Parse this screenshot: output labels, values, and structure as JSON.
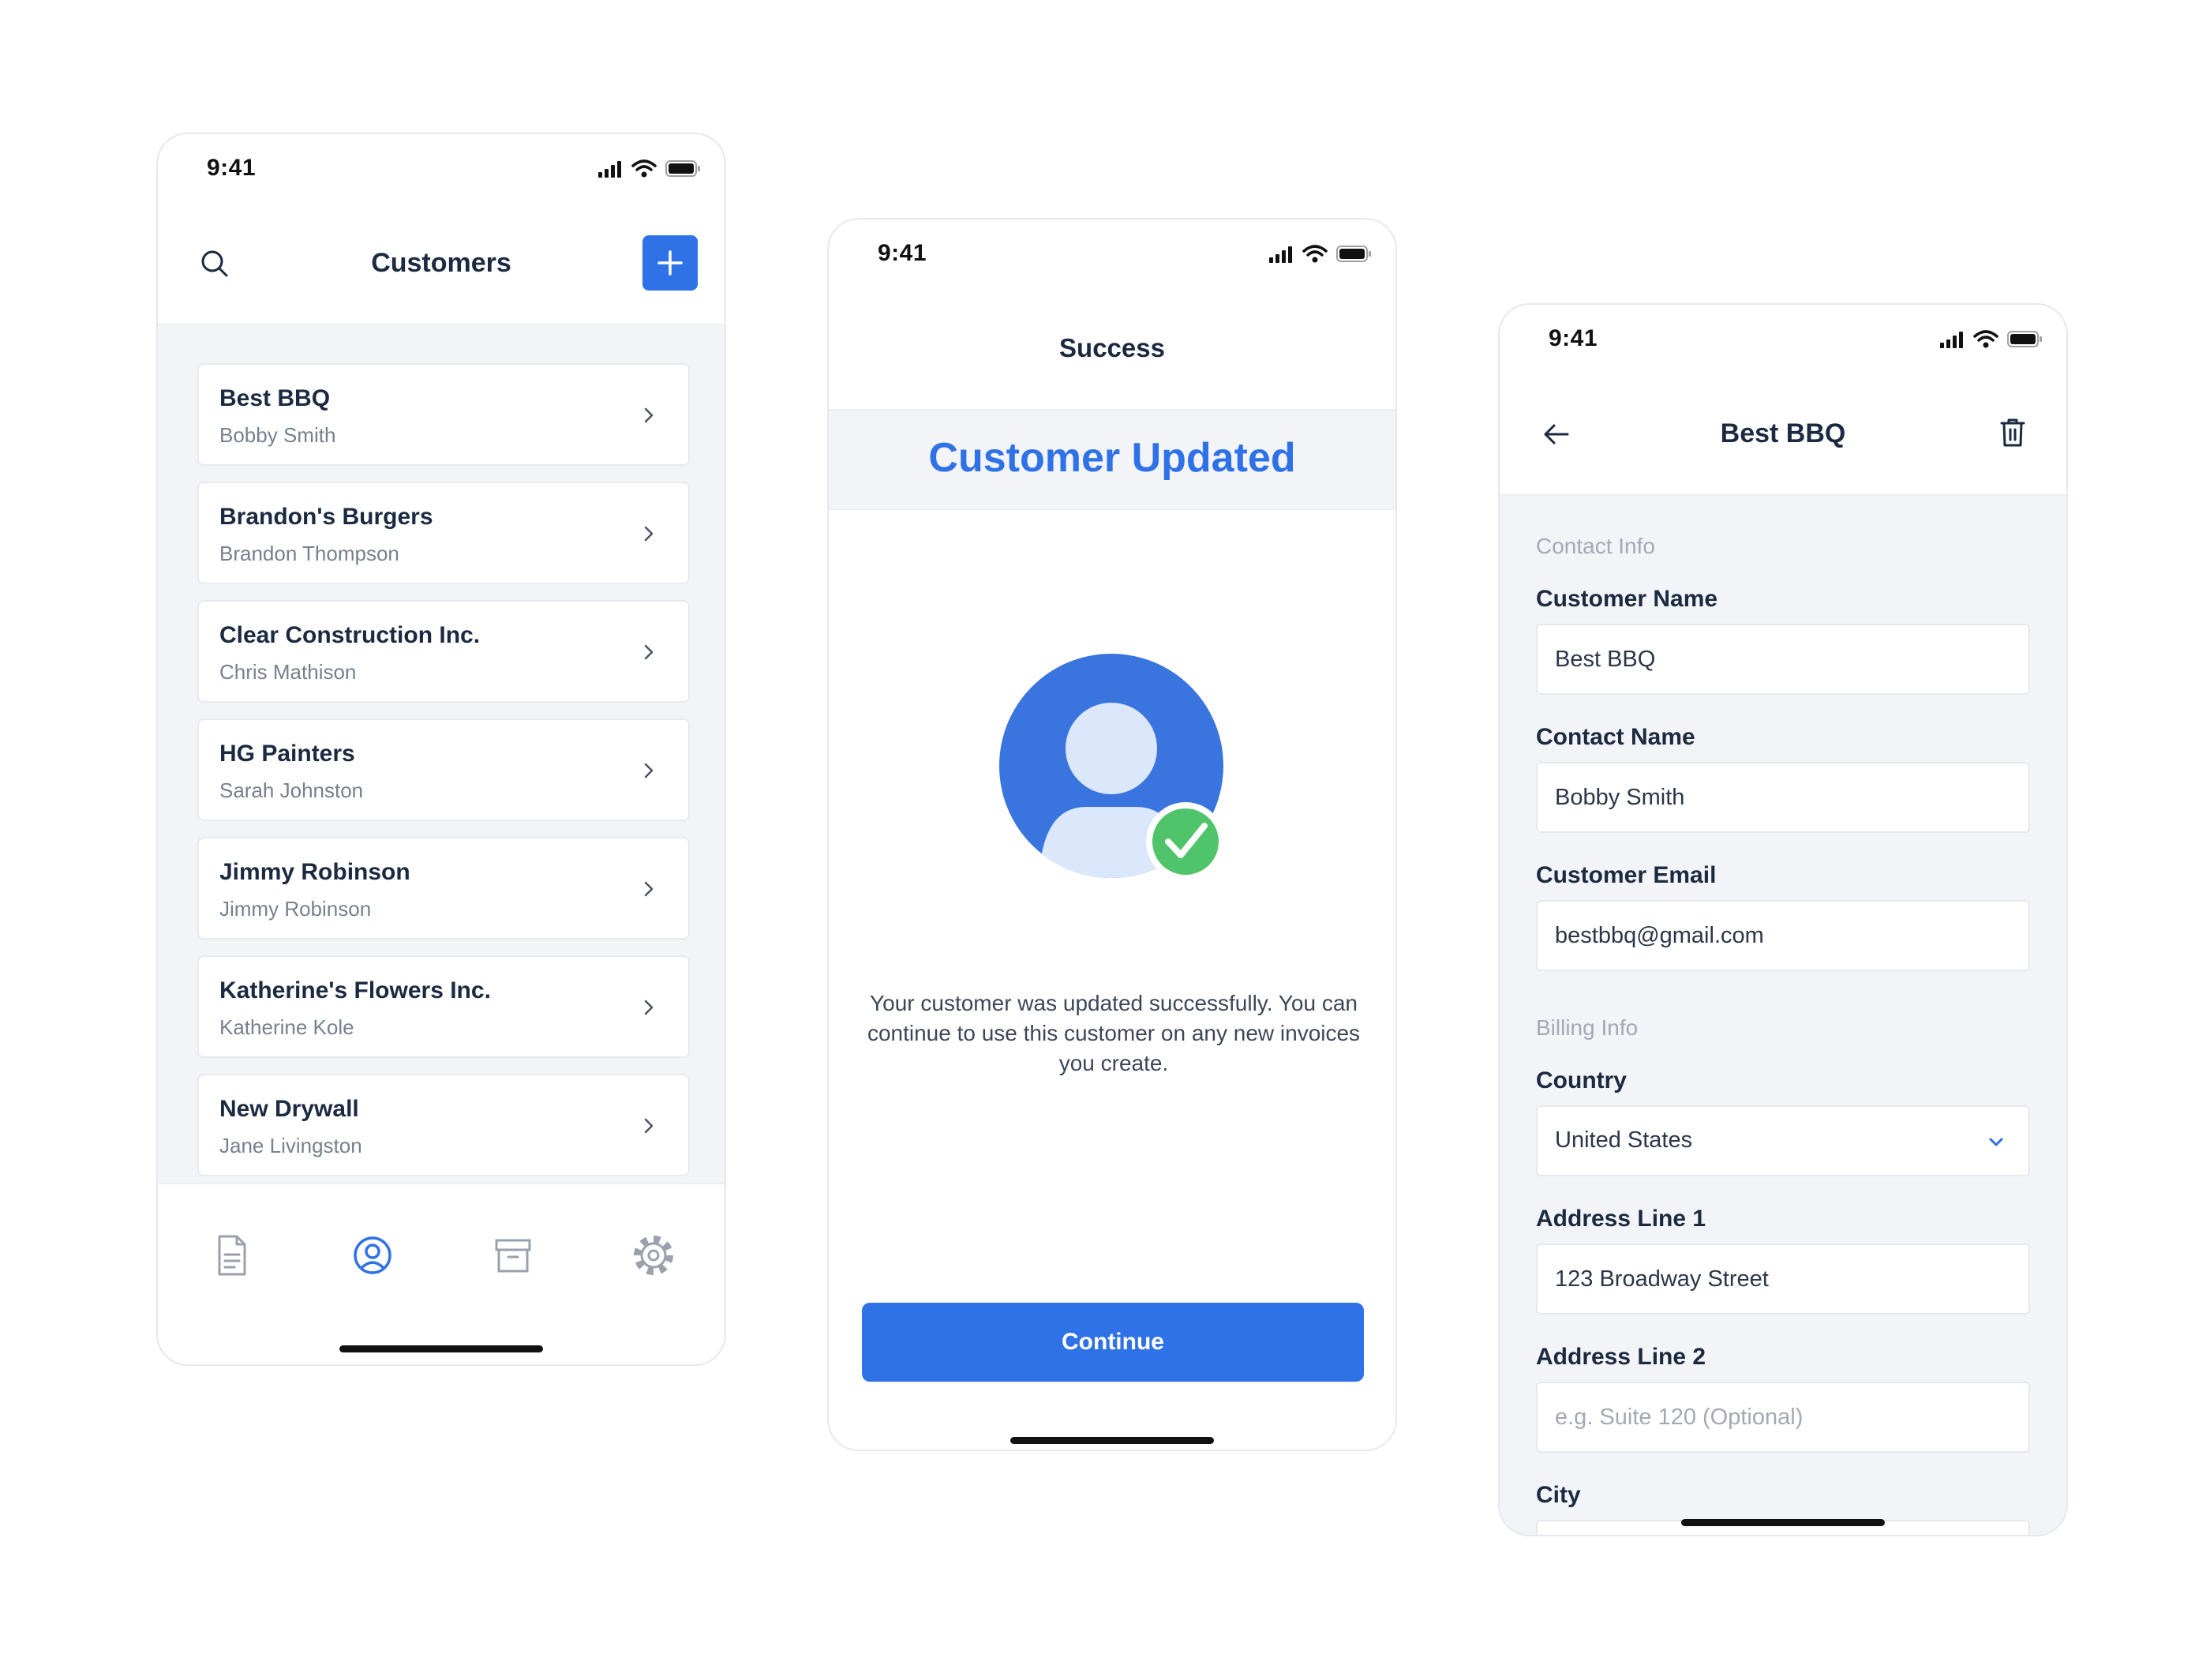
{
  "status_bar": {
    "time": "9:41"
  },
  "customers_screen": {
    "title": "Customers",
    "icons": {
      "search": "search-icon",
      "add": "plus-icon",
      "row": "chevron-right-icon"
    },
    "customers": [
      {
        "name": "Best BBQ",
        "contact": "Bobby Smith"
      },
      {
        "name": "Brandon's Burgers",
        "contact": "Brandon Thompson"
      },
      {
        "name": "Clear Construction Inc.",
        "contact": "Chris Mathison"
      },
      {
        "name": "HG Painters",
        "contact": "Sarah Johnston"
      },
      {
        "name": "Jimmy Robinson",
        "contact": "Jimmy Robinson"
      },
      {
        "name": "Katherine's Flowers Inc.",
        "contact": "Katherine Kole"
      },
      {
        "name": "New Drywall",
        "contact": "Jane Livingston"
      }
    ],
    "tabs": [
      {
        "icon": "document-icon",
        "active": false
      },
      {
        "icon": "user-circle-icon",
        "active": true
      },
      {
        "icon": "archive-icon",
        "active": false
      },
      {
        "icon": "gear-icon",
        "active": false
      }
    ]
  },
  "success_screen": {
    "title": "Success",
    "banner": "Customer Updated",
    "message": "Your customer was updated successfully. You can continue to use this customer on any new invoices you create.",
    "continue_label": "Continue",
    "icons": {
      "avatar": "user-avatar-icon",
      "badge": "checkmark-circle-icon"
    }
  },
  "edit_screen": {
    "title": "Best BBQ",
    "icons": {
      "back": "arrow-left-icon",
      "delete": "trash-icon",
      "dropdown": "chevron-down-icon"
    },
    "contact_section": "Contact Info",
    "billing_section": "Billing Info",
    "fields": {
      "customer_name": {
        "label": "Customer Name",
        "value": "Best BBQ"
      },
      "contact_name": {
        "label": "Contact Name",
        "value": "Bobby Smith"
      },
      "customer_email": {
        "label": "Customer Email",
        "value": "bestbbq@gmail.com"
      },
      "country": {
        "label": "Country",
        "value": "United States"
      },
      "address_line_1": {
        "label": "Address Line 1",
        "value": "123 Broadway Street"
      },
      "address_line_2": {
        "label": "Address Line 2",
        "value": "",
        "placeholder": "e.g. Suite 120 (Optional)"
      },
      "city": {
        "label": "City"
      }
    }
  },
  "colors": {
    "accent": "#2f72e8",
    "text": "#1b2a40",
    "muted": "#77808e",
    "background": "#f3f4f7",
    "success": "#4fc46b"
  }
}
